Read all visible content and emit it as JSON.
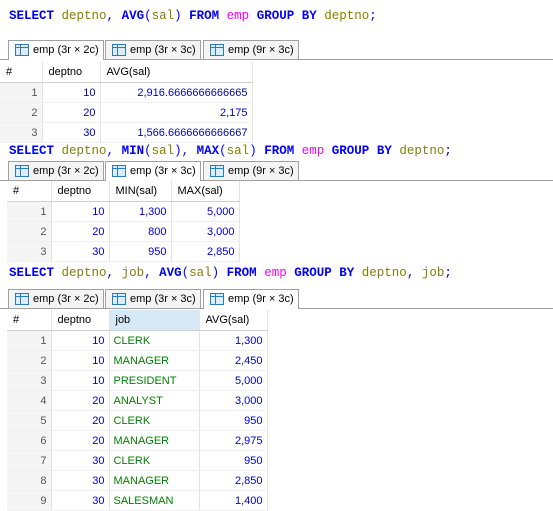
{
  "queries": [
    {
      "sql_tokens": [
        {
          "t": "SELECT",
          "c": "kw"
        },
        {
          "t": " ",
          "c": "sp"
        },
        {
          "t": "deptno",
          "c": "id"
        },
        {
          "t": ", ",
          "c": "pn"
        },
        {
          "t": "AVG",
          "c": "fn"
        },
        {
          "t": "(",
          "c": "pn"
        },
        {
          "t": "sal",
          "c": "id"
        },
        {
          "t": ")",
          "c": "pn"
        },
        {
          "t": " ",
          "c": "sp"
        },
        {
          "t": "FROM",
          "c": "kw"
        },
        {
          "t": " ",
          "c": "sp"
        },
        {
          "t": "emp",
          "c": "tbl"
        },
        {
          "t": " ",
          "c": "sp"
        },
        {
          "t": "GROUP",
          "c": "kw"
        },
        {
          "t": " ",
          "c": "sp"
        },
        {
          "t": "BY",
          "c": "kw"
        },
        {
          "t": " ",
          "c": "sp"
        },
        {
          "t": "deptno",
          "c": "id"
        },
        {
          "t": ";",
          "c": "pn"
        }
      ],
      "tabs": [
        {
          "label": "emp (3r × 2c)",
          "active": true
        },
        {
          "label": "emp (3r × 3c)",
          "active": false
        },
        {
          "label": "emp (9r × 3c)",
          "active": false
        }
      ],
      "columns": [
        "#",
        "deptno",
        "AVG(sal)"
      ],
      "rows": [
        [
          "1",
          "10",
          "2,916.6666666666665"
        ],
        [
          "2",
          "20",
          "2,175"
        ],
        [
          "3",
          "30",
          "1,566.6666666666667"
        ]
      ]
    },
    {
      "sql_tokens": [
        {
          "t": "SELECT",
          "c": "kw"
        },
        {
          "t": " ",
          "c": "sp"
        },
        {
          "t": "deptno",
          "c": "id"
        },
        {
          "t": ", ",
          "c": "pn"
        },
        {
          "t": "MIN",
          "c": "fn"
        },
        {
          "t": "(",
          "c": "pn"
        },
        {
          "t": "sal",
          "c": "id"
        },
        {
          "t": ")",
          "c": "pn"
        },
        {
          "t": ", ",
          "c": "pn"
        },
        {
          "t": "MAX",
          "c": "fn"
        },
        {
          "t": "(",
          "c": "pn"
        },
        {
          "t": "sal",
          "c": "id"
        },
        {
          "t": ")",
          "c": "pn"
        },
        {
          "t": " ",
          "c": "sp"
        },
        {
          "t": "FROM",
          "c": "kw"
        },
        {
          "t": " ",
          "c": "sp"
        },
        {
          "t": "emp",
          "c": "tbl"
        },
        {
          "t": " ",
          "c": "sp"
        },
        {
          "t": "GROUP",
          "c": "kw"
        },
        {
          "t": " ",
          "c": "sp"
        },
        {
          "t": "BY",
          "c": "kw"
        },
        {
          "t": " ",
          "c": "sp"
        },
        {
          "t": "deptno",
          "c": "id"
        },
        {
          "t": ";",
          "c": "pn"
        }
      ],
      "tabs": [
        {
          "label": "emp (3r × 2c)",
          "active": false
        },
        {
          "label": "emp (3r × 3c)",
          "active": true
        },
        {
          "label": "emp (9r × 3c)",
          "active": false
        }
      ],
      "columns": [
        "#",
        "deptno",
        "MIN(sal)",
        "MAX(sal)"
      ],
      "rows": [
        [
          "1",
          "10",
          "1,300",
          "5,000"
        ],
        [
          "2",
          "20",
          "800",
          "3,000"
        ],
        [
          "3",
          "30",
          "950",
          "2,850"
        ]
      ]
    },
    {
      "sql_tokens": [
        {
          "t": "SELECT",
          "c": "kw"
        },
        {
          "t": " ",
          "c": "sp"
        },
        {
          "t": "deptno",
          "c": "id"
        },
        {
          "t": ", ",
          "c": "pn"
        },
        {
          "t": "job",
          "c": "id"
        },
        {
          "t": ", ",
          "c": "pn"
        },
        {
          "t": "AVG",
          "c": "fn"
        },
        {
          "t": "(",
          "c": "pn"
        },
        {
          "t": "sal",
          "c": "id"
        },
        {
          "t": ")",
          "c": "pn"
        },
        {
          "t": " ",
          "c": "sp"
        },
        {
          "t": "FROM",
          "c": "kw"
        },
        {
          "t": " ",
          "c": "sp"
        },
        {
          "t": "emp",
          "c": "tbl"
        },
        {
          "t": " ",
          "c": "sp"
        },
        {
          "t": "GROUP",
          "c": "kw"
        },
        {
          "t": " ",
          "c": "sp"
        },
        {
          "t": "BY",
          "c": "kw"
        },
        {
          "t": " ",
          "c": "sp"
        },
        {
          "t": "deptno",
          "c": "id"
        },
        {
          "t": ", ",
          "c": "pn"
        },
        {
          "t": "job",
          "c": "id"
        },
        {
          "t": ";",
          "c": "pn"
        }
      ],
      "tabs": [
        {
          "label": "emp (3r × 2c)",
          "active": false
        },
        {
          "label": "emp (3r × 3c)",
          "active": false
        },
        {
          "label": "emp (9r × 3c)",
          "active": true
        }
      ],
      "columns": [
        "#",
        "deptno",
        "job",
        "AVG(sal)"
      ],
      "highlight_column": "job",
      "rows": [
        [
          "1",
          "10",
          "CLERK",
          "1,300"
        ],
        [
          "2",
          "10",
          "MANAGER",
          "2,450"
        ],
        [
          "3",
          "10",
          "PRESIDENT",
          "5,000"
        ],
        [
          "4",
          "20",
          "ANALYST",
          "3,000"
        ],
        [
          "5",
          "20",
          "CLERK",
          "950"
        ],
        [
          "6",
          "20",
          "MANAGER",
          "2,975"
        ],
        [
          "7",
          "30",
          "CLERK",
          "950"
        ],
        [
          "8",
          "30",
          "MANAGER",
          "2,850"
        ],
        [
          "9",
          "30",
          "SALESMAN",
          "1,400"
        ]
      ]
    }
  ]
}
